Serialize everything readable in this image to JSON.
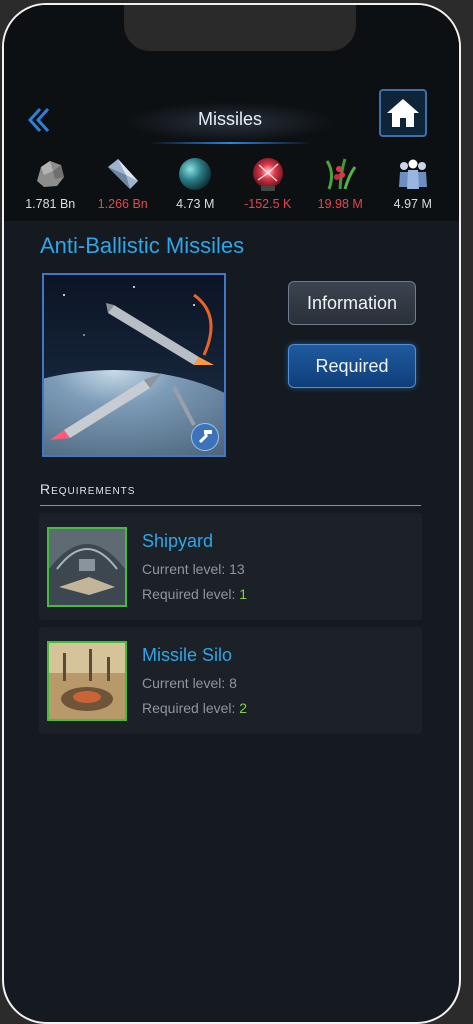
{
  "header": {
    "title": "Missiles",
    "back_icon": "chevron-left-double-icon",
    "home_icon": "home-icon"
  },
  "resources": [
    {
      "icon": "metal-ore-icon",
      "value": "1.781 Bn",
      "color": "#d7dde3"
    },
    {
      "icon": "crystal-icon",
      "value": "1.266 Bn",
      "color": "#e2474f"
    },
    {
      "icon": "deuterium-orb-icon",
      "value": "4.73 M",
      "color": "#d7dde3"
    },
    {
      "icon": "energy-plasma-icon",
      "value": "-152.5 K",
      "color": "#e2474f"
    },
    {
      "icon": "food-plant-icon",
      "value": "19.98 M",
      "color": "#e2474f"
    },
    {
      "icon": "population-icon",
      "value": "4.97 M",
      "color": "#d7dde3"
    }
  ],
  "item": {
    "name": "Anti-Ballistic Missiles",
    "image_icon": "anti-ballistic-missiles-image",
    "badge_icon": "hammer-icon"
  },
  "buttons": {
    "information": "Information",
    "required": "Required"
  },
  "requirements": {
    "title": "Requirements",
    "items": [
      {
        "name": "Shipyard",
        "current_label": "Current level: 13",
        "required_prefix": "Required level: ",
        "required_value": "1"
      },
      {
        "name": "Missile Silo",
        "current_label": "Current level: 8",
        "required_prefix": "Required level: ",
        "required_value": "2"
      }
    ]
  }
}
